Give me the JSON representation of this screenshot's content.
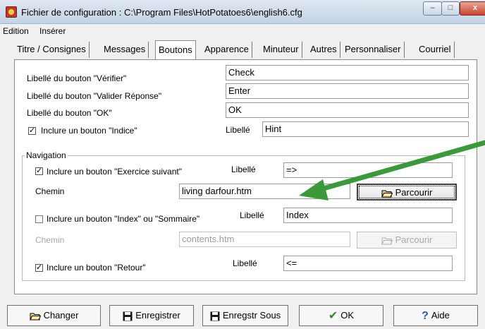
{
  "window": {
    "title": "Fichier de configuration : C:\\Program Files\\HotPotatoes6\\english6.cfg",
    "controls": {
      "minimize": "–",
      "maximize": "□",
      "close": "x"
    }
  },
  "menu": [
    "Edition",
    "Insérer"
  ],
  "tabs": [
    {
      "label": "Titre / Consignes"
    },
    {
      "label": "Messages"
    },
    {
      "label": "Boutons"
    },
    {
      "label": "Apparence"
    },
    {
      "label": "Minuteur"
    },
    {
      "label": "Autres"
    },
    {
      "label": "Personnaliser"
    },
    {
      "label": "Courriel"
    }
  ],
  "active_tab": "Boutons",
  "buttons_tab": {
    "check_label": "Libellé du bouton \"Vérifier\"",
    "check_value": "Check",
    "enter_label": "Libellé du bouton \"Valider Réponse\"",
    "enter_value": "Enter",
    "ok_label": "Libellé du bouton \"OK\"",
    "ok_value": "OK",
    "hint_checkbox_label": "Inclure un bouton \"Indice\"",
    "hint_checked": true,
    "hint_libelle": "Libellé",
    "hint_value": "Hint"
  },
  "navigation": {
    "group_title": "Navigation",
    "next_checkbox_label": "Inclure un bouton \"Exercice suivant\"",
    "next_checked": true,
    "next_libelle": "Libellé",
    "next_value": "=>",
    "next_path_label": "Chemin",
    "next_path_value": "living darfour.htm",
    "browse_label": "Parcourir",
    "index_checkbox_label": "Inclure un bouton \"Index\" ou \"Sommaire\"",
    "index_checked": false,
    "index_libelle": "Libellé",
    "index_value": "Index",
    "index_path_label": "Chemin",
    "index_path_value": "contents.htm",
    "index_browse_label": "Parcourir",
    "back_checkbox_label": "Inclure un bouton \"Retour\"",
    "back_checked": true,
    "back_libelle": "Libellé",
    "back_value": "<="
  },
  "bottom_buttons": {
    "change": "Changer",
    "save": "Enregistrer",
    "save_as": "Enregstr Sous",
    "ok": "OK",
    "help": "Aide"
  },
  "colors": {
    "annotation_arrow": "#3a9a3a",
    "title_bar": "#c9d8ea",
    "close_button": "#c9452f"
  }
}
